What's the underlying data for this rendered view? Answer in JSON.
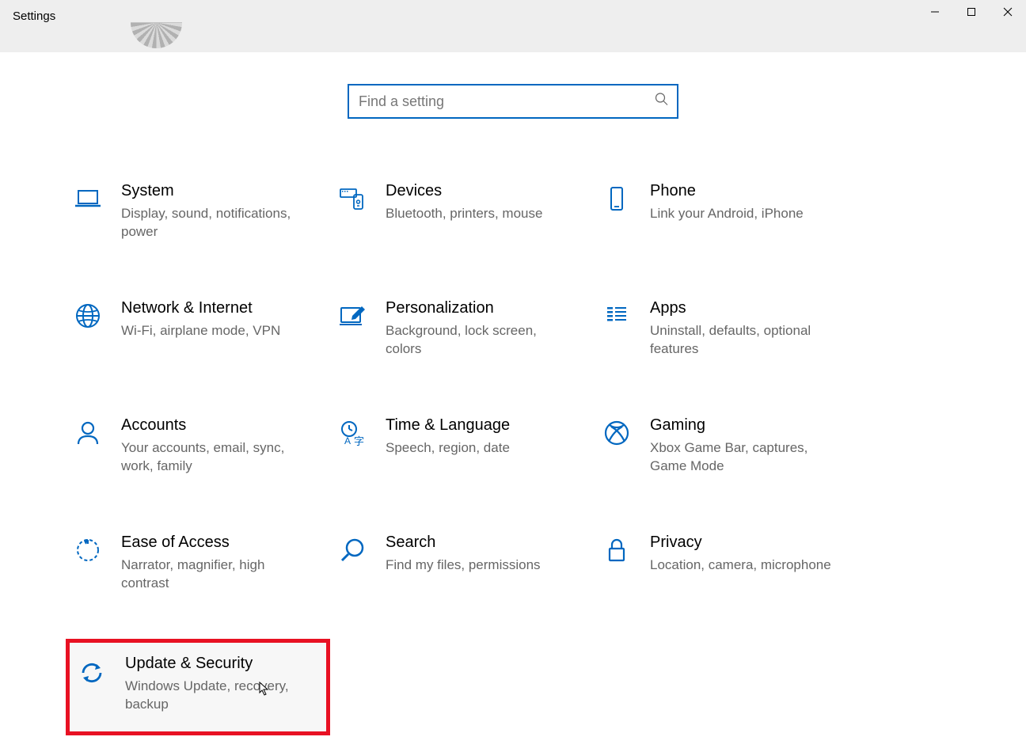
{
  "window": {
    "title": "Settings"
  },
  "search": {
    "placeholder": "Find a setting"
  },
  "tiles": [
    {
      "id": "system",
      "title": "System",
      "desc": "Display, sound, notifications, power",
      "icon": "laptop-icon"
    },
    {
      "id": "devices",
      "title": "Devices",
      "desc": "Bluetooth, printers, mouse",
      "icon": "devices-icon"
    },
    {
      "id": "phone",
      "title": "Phone",
      "desc": "Link your Android, iPhone",
      "icon": "phone-icon"
    },
    {
      "id": "network",
      "title": "Network & Internet",
      "desc": "Wi-Fi, airplane mode, VPN",
      "icon": "globe-icon"
    },
    {
      "id": "personalization",
      "title": "Personalization",
      "desc": "Background, lock screen, colors",
      "icon": "pen-icon"
    },
    {
      "id": "apps",
      "title": "Apps",
      "desc": "Uninstall, defaults, optional features",
      "icon": "apps-icon"
    },
    {
      "id": "accounts",
      "title": "Accounts",
      "desc": "Your accounts, email, sync, work, family",
      "icon": "person-icon"
    },
    {
      "id": "time",
      "title": "Time & Language",
      "desc": "Speech, region, date",
      "icon": "time-lang-icon"
    },
    {
      "id": "gaming",
      "title": "Gaming",
      "desc": "Xbox Game Bar, captures, Game Mode",
      "icon": "xbox-icon"
    },
    {
      "id": "ease",
      "title": "Ease of Access",
      "desc": "Narrator, magnifier, high contrast",
      "icon": "ease-icon"
    },
    {
      "id": "search-cat",
      "title": "Search",
      "desc": "Find my files, permissions",
      "icon": "magnifier-icon"
    },
    {
      "id": "privacy",
      "title": "Privacy",
      "desc": "Location, camera, microphone",
      "icon": "lock-icon"
    },
    {
      "id": "update",
      "title": "Update & Security",
      "desc": "Windows Update, recovery, backup",
      "icon": "update-icon",
      "highlighted": true
    }
  ]
}
